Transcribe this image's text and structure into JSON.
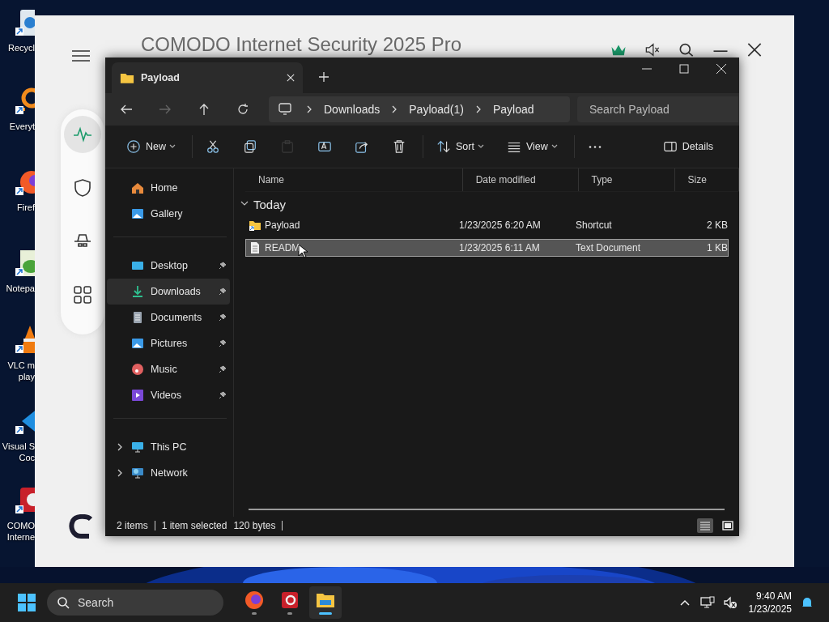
{
  "desktop": {
    "icons": [
      {
        "label": [
          "Recycl"
        ]
      },
      {
        "label": [
          "Everyt"
        ]
      },
      {
        "label": [
          "Firef"
        ]
      },
      {
        "label": [
          "Notepa"
        ]
      },
      {
        "label": [
          "VLC m",
          "play"
        ]
      },
      {
        "label": [
          "Visual S",
          "Coc"
        ]
      },
      {
        "label": [
          "COMO",
          "Interne"
        ]
      }
    ]
  },
  "comodo": {
    "title": "COMODO Internet Security 2025 Pro",
    "nav": [
      {
        "selected": true
      },
      {
        "selected": false
      },
      {
        "selected": false
      },
      {
        "selected": false
      }
    ]
  },
  "explorer": {
    "tab": {
      "title": "Payload"
    },
    "breadcrumb": [
      "Downloads",
      "Payload(1)",
      "Payload"
    ],
    "search": {
      "placeholder": "Search Payload"
    },
    "toolbar": [
      {
        "label": "New",
        "dropdown": true,
        "disabled": false
      },
      {
        "disabled": false
      },
      {
        "disabled": false
      },
      {
        "disabled": true
      },
      {
        "disabled": false
      },
      {
        "disabled": false
      },
      {
        "disabled": false
      },
      {
        "label": "Sort",
        "dropdown": true,
        "disabled": false
      },
      {
        "label": "View",
        "dropdown": true,
        "disabled": false
      },
      {
        "disabled": false
      },
      {
        "label": "Details",
        "dropdown": false,
        "disabled": false
      }
    ],
    "nav": [
      [
        {
          "label": "Home",
          "selected": false
        },
        {
          "label": "Gallery",
          "selected": false
        }
      ],
      [
        {
          "label": "Desktop",
          "pinned": true,
          "selected": false
        },
        {
          "label": "Downloads",
          "pinned": true,
          "selected": true
        },
        {
          "label": "Documents",
          "pinned": true,
          "selected": false
        },
        {
          "label": "Pictures",
          "pinned": true,
          "selected": false
        },
        {
          "label": "Music",
          "pinned": true,
          "selected": false
        },
        {
          "label": "Videos",
          "pinned": true,
          "selected": false
        }
      ],
      [
        {
          "label": "This PC",
          "expanded": false,
          "selected": false
        },
        {
          "label": "Network",
          "expanded": false,
          "selected": false
        }
      ]
    ],
    "columns": [
      "Name",
      "Date modified",
      "Type",
      "Size"
    ],
    "group": {
      "label": "Today",
      "expanded": true
    },
    "rows": [
      {
        "kind": "shortcut",
        "name": "Payload",
        "date": "1/23/2025 6:20 AM",
        "type": "Shortcut",
        "size": "2 KB",
        "selected": false
      },
      {
        "kind": "text",
        "name": "READM",
        "date": "1/23/2025 6:11 AM",
        "type": "Text Document",
        "size": "1 KB",
        "selected": true
      }
    ],
    "status": [
      "2 items",
      "1 item selected",
      "120 bytes"
    ],
    "views": [
      {
        "selected": true
      },
      {
        "selected": false
      }
    ]
  },
  "taskbar": {
    "search": {
      "placeholder": "Search"
    },
    "apps": [
      {
        "selected": false
      },
      {
        "selected": false
      },
      {
        "selected": true
      }
    ],
    "time": "9:40 AM",
    "date": "1/23/2025"
  }
}
